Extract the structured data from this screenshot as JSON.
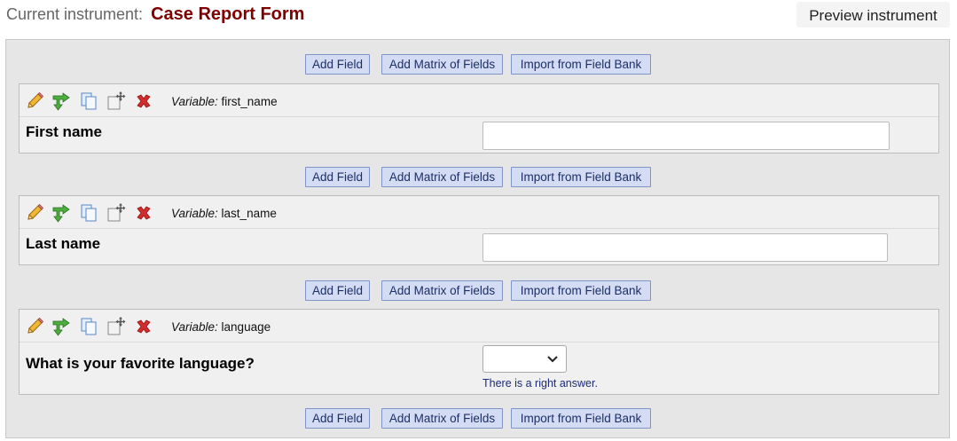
{
  "header": {
    "label": "Current instrument:",
    "instrument_name": "Case Report Form",
    "preview_label": "Preview instrument"
  },
  "buttons": {
    "add_field": "Add Field",
    "add_matrix": "Add Matrix of Fields",
    "import_bank": "Import from Field Bank"
  },
  "variable_prefix": "Variable:",
  "fields": [
    {
      "variable": "first_name",
      "label": "First name",
      "type": "text"
    },
    {
      "variable": "last_name",
      "label": "Last name",
      "type": "text"
    },
    {
      "variable": "language",
      "label": "What is your favorite language?",
      "type": "dropdown",
      "hint": "There is a right answer."
    }
  ],
  "icons": [
    "pencil-icon",
    "branching-arrow-icon",
    "copy-icon",
    "move-icon",
    "delete-x-icon"
  ],
  "colors": {
    "instrument_name": "#800000",
    "button_bg": "#d4dcf4",
    "button_text": "#1b2f66",
    "hint_text": "#1a2a78"
  }
}
